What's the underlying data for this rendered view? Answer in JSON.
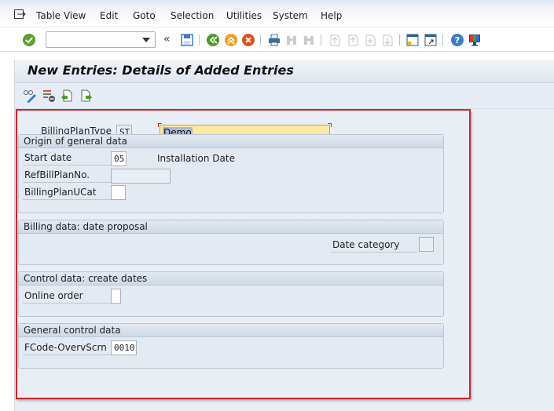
{
  "menubar": {
    "items": [
      "Table View",
      "Edit",
      "Goto",
      "Selection",
      "Utilities",
      "System",
      "Help"
    ]
  },
  "toolbar": {
    "command_field": {
      "value": "",
      "placeholder": ""
    },
    "icons": [
      "enter-icon",
      "back-double-arrow-icon",
      "save-icon",
      "back-icon",
      "exit-icon",
      "cancel-icon",
      "print-icon",
      "find-icon",
      "find-next-icon",
      "first-page-icon",
      "previous-page-icon",
      "next-page-icon",
      "last-page-icon",
      "create-session-icon",
      "shortcut-icon",
      "help-icon",
      "customize-layout-icon"
    ]
  },
  "screen": {
    "title": "New Entries: Details of Added Entries"
  },
  "header_fields": {
    "billing_plan_type": {
      "label": "BillingPlanType",
      "value": "ST",
      "description": "Demo"
    }
  },
  "groups": [
    {
      "title": "Origin of general data",
      "fields": [
        {
          "label": "Start date",
          "value": "05",
          "text": "Installation Date"
        },
        {
          "label": "RefBillPlanNo.",
          "value": ""
        },
        {
          "label": "BillingPlanUCat",
          "value": ""
        }
      ]
    },
    {
      "title": "Billing data: date proposal",
      "fields": [
        {
          "label": "Date category",
          "value": ""
        }
      ]
    },
    {
      "title": "Control data: create dates",
      "fields": [
        {
          "label": "Online order",
          "value": ""
        }
      ]
    },
    {
      "title": "General control data",
      "fields": [
        {
          "label": "FCode-OvervScrn",
          "value": "0010"
        }
      ]
    }
  ],
  "colors": {
    "highlight_border": "#d0242c",
    "input_highlight": "#fdeaa0"
  }
}
